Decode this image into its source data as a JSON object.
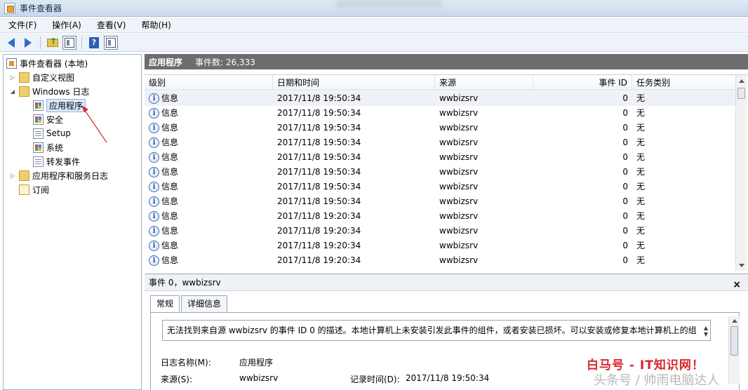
{
  "window": {
    "title": "事件查看器"
  },
  "menu": [
    "文件(F)",
    "操作(A)",
    "查看(V)",
    "帮助(H)"
  ],
  "tree": {
    "root": "事件查看器 (本地)",
    "items": [
      {
        "label": "自定义视图"
      },
      {
        "label": "Windows 日志"
      },
      {
        "label": "应用程序"
      },
      {
        "label": "安全"
      },
      {
        "label": "Setup"
      },
      {
        "label": "系统"
      },
      {
        "label": "转发事件"
      },
      {
        "label": "应用程序和服务日志"
      },
      {
        "label": "订阅"
      }
    ]
  },
  "header": {
    "log_name": "应用程序",
    "count_text": "事件数: 26,333"
  },
  "table": {
    "columns": [
      "级别",
      "日期和时间",
      "来源",
      "事件 ID",
      "任务类别"
    ],
    "rows": [
      {
        "level": "信息",
        "datetime": "2017/11/8 19:50:34",
        "source": "wwbizsrv",
        "event_id": "0",
        "category": "无"
      },
      {
        "level": "信息",
        "datetime": "2017/11/8 19:50:34",
        "source": "wwbizsrv",
        "event_id": "0",
        "category": "无"
      },
      {
        "level": "信息",
        "datetime": "2017/11/8 19:50:34",
        "source": "wwbizsrv",
        "event_id": "0",
        "category": "无"
      },
      {
        "level": "信息",
        "datetime": "2017/11/8 19:50:34",
        "source": "wwbizsrv",
        "event_id": "0",
        "category": "无"
      },
      {
        "level": "信息",
        "datetime": "2017/11/8 19:50:34",
        "source": "wwbizsrv",
        "event_id": "0",
        "category": "无"
      },
      {
        "level": "信息",
        "datetime": "2017/11/8 19:50:34",
        "source": "wwbizsrv",
        "event_id": "0",
        "category": "无"
      },
      {
        "level": "信息",
        "datetime": "2017/11/8 19:50:34",
        "source": "wwbizsrv",
        "event_id": "0",
        "category": "无"
      },
      {
        "level": "信息",
        "datetime": "2017/11/8 19:50:34",
        "source": "wwbizsrv",
        "event_id": "0",
        "category": "无"
      },
      {
        "level": "信息",
        "datetime": "2017/11/8 19:20:34",
        "source": "wwbizsrv",
        "event_id": "0",
        "category": "无"
      },
      {
        "level": "信息",
        "datetime": "2017/11/8 19:20:34",
        "source": "wwbizsrv",
        "event_id": "0",
        "category": "无"
      },
      {
        "level": "信息",
        "datetime": "2017/11/8 19:20:34",
        "source": "wwbizsrv",
        "event_id": "0",
        "category": "无"
      },
      {
        "level": "信息",
        "datetime": "2017/11/8 19:20:34",
        "source": "wwbizsrv",
        "event_id": "0",
        "category": "无"
      }
    ]
  },
  "detail": {
    "title": "事件 0，wwbizsrv",
    "tabs": [
      "常规",
      "详细信息"
    ],
    "description": "无法找到来自源 wwbizsrv 的事件 ID 0 的描述。本地计算机上未安装引发此事件的组件，或者安装已损坏。可以安装或修复本地计算机上的组",
    "fields": {
      "log_name_label": "日志名称(M):",
      "log_name_value": "应用程序",
      "source_label": "来源(S):",
      "source_value": "wwbizsrv",
      "record_time_label": "记录时间(D):",
      "record_time_value": "2017/11/8 19:50:34"
    }
  },
  "watermark": {
    "red": "白马号 - IT知识网！",
    "gray": "头条号 / 帅雨电脑达人"
  },
  "colors": {
    "header_band": "#6d6d6d",
    "annotation_arrow": "#d8262c",
    "watermark_red": "#d8262c"
  }
}
